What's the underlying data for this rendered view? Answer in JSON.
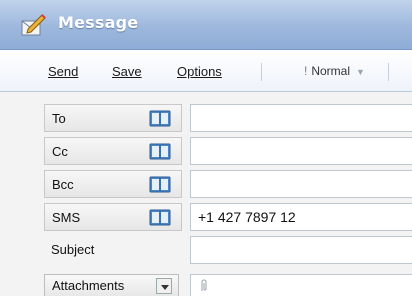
{
  "window": {
    "title": "Message"
  },
  "toolbar": {
    "send_label": "Send",
    "save_label": "Save",
    "options_label": "Options",
    "priority": {
      "icon": "!",
      "value": "Normal"
    }
  },
  "fields": {
    "to": {
      "label": "To",
      "value": ""
    },
    "cc": {
      "label": "Cc",
      "value": ""
    },
    "bcc": {
      "label": "Bcc",
      "value": ""
    },
    "sms": {
      "label": "SMS",
      "value": "+1 427 7897 12"
    },
    "subject": {
      "label": "Subject",
      "value": ""
    },
    "attachments": {
      "label": "Attachments",
      "value": ""
    }
  },
  "colors": {
    "titlebar": "#9db8dd",
    "title_text": "#ffffff",
    "book_icon": "#4a86c8"
  }
}
